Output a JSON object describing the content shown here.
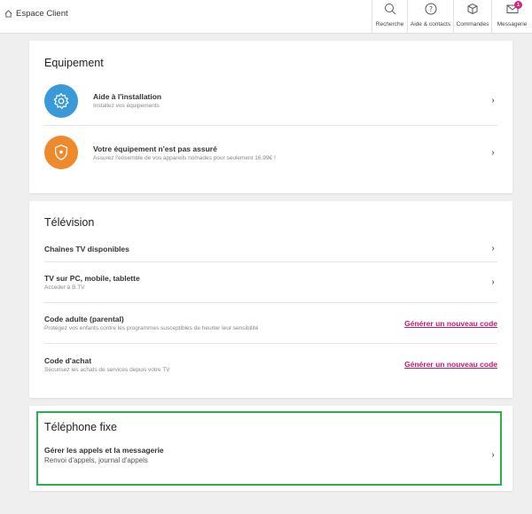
{
  "header": {
    "brand": "Espace Client",
    "nav": [
      {
        "label": "Recherche",
        "icon": "search-icon"
      },
      {
        "label": "Aide & contacts",
        "icon": "help-icon"
      },
      {
        "label": "Commandes",
        "icon": "box-icon"
      },
      {
        "label": "Messagerie",
        "icon": "mail-icon",
        "badge": "1"
      }
    ]
  },
  "equipement": {
    "title": "Equipement",
    "items": [
      {
        "title": "Aide à l'installation",
        "subtitle": "Installez vos équipements",
        "icon": "gear-icon",
        "color": "#3a9ad9"
      },
      {
        "title": "Votre équipement n'est pas assuré",
        "subtitle": "Assurez l'ensemble de vos appareils nomades pour seulement 16.99€ !",
        "icon": "shield-icon",
        "color": "#ee8a2b"
      }
    ]
  },
  "television": {
    "title": "Télévision",
    "items": [
      {
        "title": "Chaînes TV disponibles",
        "subtitle": ""
      },
      {
        "title": "TV sur PC, mobile, tablette",
        "subtitle": "Accéder à B.TV"
      },
      {
        "title": "Code adulte (parental)",
        "subtitle": "Protégez vos enfants contre les programmes susceptibles de heurter leur sensibilité",
        "action": "Générer un nouveau code"
      },
      {
        "title": "Code d'achat",
        "subtitle": "Sécurisez les achats de services depuis votre TV",
        "action": "Générer un nouveau code"
      }
    ]
  },
  "telephone": {
    "title": "Téléphone fixe",
    "items": [
      {
        "title": "Gérer les appels et la messagerie",
        "subtitle": "Renvoi d'appels, journal d'appels"
      }
    ]
  },
  "colors": {
    "accent_link": "#c21a72",
    "highlight": "#2cb04f"
  }
}
